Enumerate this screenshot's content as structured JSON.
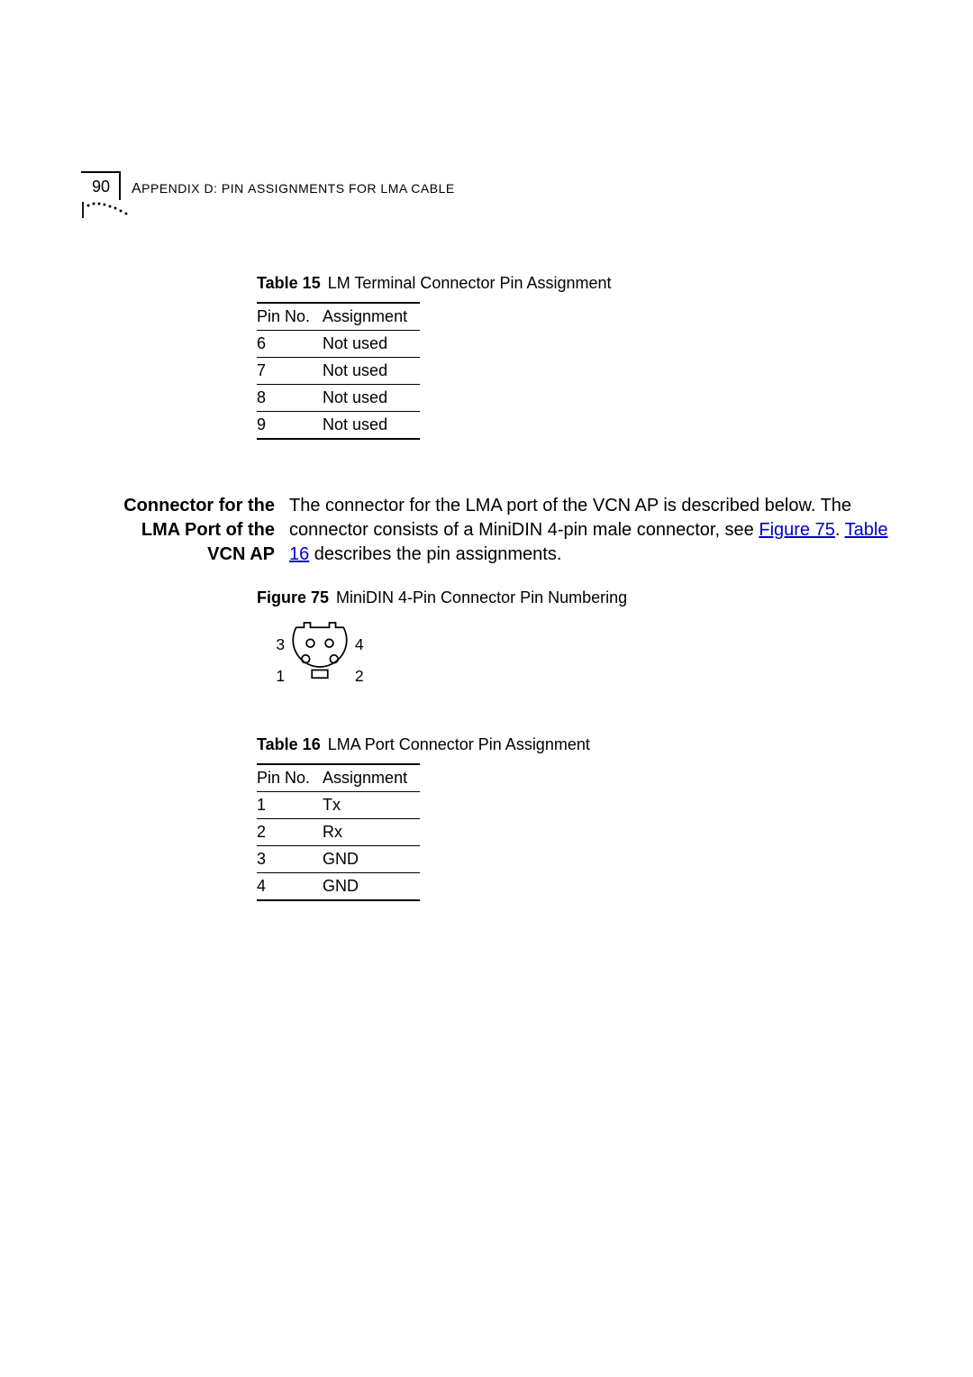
{
  "header": {
    "page_number": "90",
    "appendix_label": "A",
    "appendix_text_1": "PPENDIX",
    "appendix_d": " D: P",
    "appendix_text_2": "IN ",
    "appendix_a2": "A",
    "appendix_text_3": "SSIGNMENTS FOR ",
    "appendix_l": "LMA C",
    "appendix_text_4": "ABLE"
  },
  "table15": {
    "caption_label": "Table 15",
    "caption_text": "LM Terminal Connector Pin Assignment",
    "col1": "Pin No.",
    "col2": "Assignment",
    "rows": [
      {
        "pin": "6",
        "assign": "Not used"
      },
      {
        "pin": "7",
        "assign": "Not used"
      },
      {
        "pin": "8",
        "assign": "Not used"
      },
      {
        "pin": "9",
        "assign": "Not used"
      }
    ]
  },
  "section": {
    "sidehead": "Connector for the LMA Port of the VCN AP",
    "para_pre": "The connector for the LMA port of the VCN AP is described below. The connector consists of a MiniDIN 4-pin male connector, see ",
    "xref1": "Figure 75",
    "para_mid1": ". ",
    "xref2": "Table 16",
    "para_post": " describes the pin assignments."
  },
  "figure75": {
    "caption_label": "Figure 75",
    "caption_text": "MiniDIN 4-Pin Connector Pin Numbering",
    "labels": {
      "l3": "3",
      "l4": "4",
      "l1": "1",
      "l2": "2"
    }
  },
  "table16": {
    "caption_label": "Table 16",
    "caption_text": "LMA Port Connector Pin Assignment",
    "col1": "Pin No.",
    "col2": "Assignment",
    "rows": [
      {
        "pin": "1",
        "assign": "Tx"
      },
      {
        "pin": "2",
        "assign": "Rx"
      },
      {
        "pin": "3",
        "assign": "GND"
      },
      {
        "pin": "4",
        "assign": "GND"
      }
    ]
  }
}
